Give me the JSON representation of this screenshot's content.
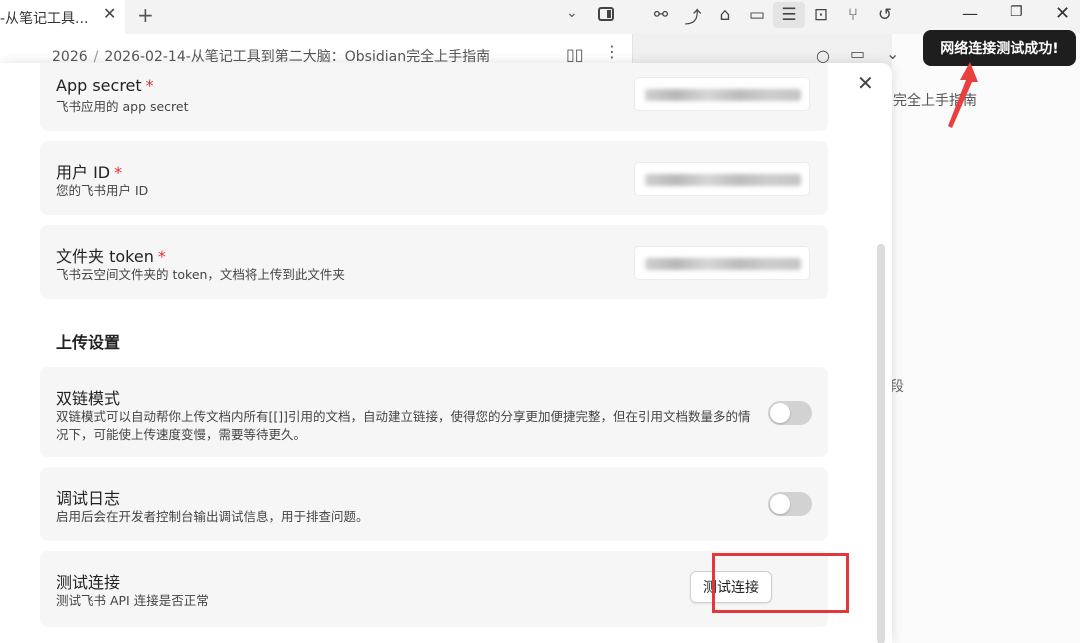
{
  "app": {
    "tab_title": "-从笔记工具...",
    "tab_close": "✕",
    "new_tab": "+",
    "breadcrumb": [
      "2026",
      "2026-02-14-从笔记工具到第二大脑：Obsidian完全上手指南"
    ],
    "breadcrumb_sep": "/",
    "right_pane_title": "完全上手指南",
    "right_pane_fragment": "段"
  },
  "toolbar_icons": [
    "link-icon",
    "share-icon",
    "tag-icon",
    "archive-icon",
    "outline-icon",
    "robot-icon",
    "branch-icon",
    "history-icon"
  ],
  "window_controls": {
    "minimize": "—",
    "maximize": "❐",
    "close": "✕"
  },
  "tooltip": {
    "text": "网络连接测试成功!"
  },
  "modal": {
    "close": "✕",
    "fields": [
      {
        "title": "App secret",
        "required": "*",
        "desc": "飞书应用的 app secret"
      },
      {
        "title": "用户 ID",
        "required": "*",
        "desc": "您的飞书用户 ID"
      },
      {
        "title": "文件夹 token",
        "required": "*",
        "desc": "飞书云空间文件夹的 token，文档将上传到此文件夹"
      }
    ],
    "section_title": "上传设置",
    "settings": [
      {
        "title": "双链模式",
        "desc": "双链模式可以自动帮你上传文档内所有[[]]引用的文档，自动建立链接，使得您的分享更加便捷完整，但在引用文档数量多的情况下，可能使上传速度变慢，需要等待更久。",
        "enabled": false
      },
      {
        "title": "调试日志",
        "desc": "启用后会在开发者控制台输出调试信息，用于排查问题。",
        "enabled": false
      }
    ],
    "test": {
      "title": "测试连接",
      "desc": "测试飞书 API 连接是否正常",
      "button": "测试连接"
    }
  },
  "colors": {
    "required": "#e03131",
    "highlight": "#e0383b",
    "tooltip_bg": "#1e1e1e"
  }
}
